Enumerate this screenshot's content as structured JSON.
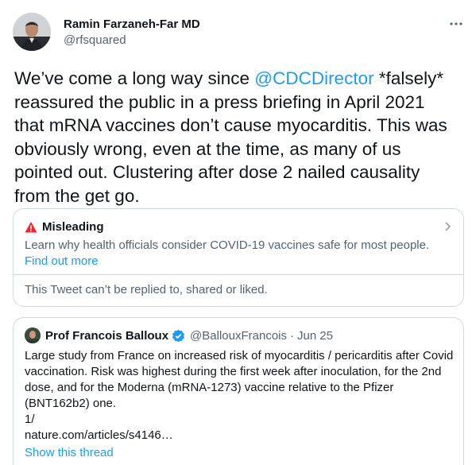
{
  "author": {
    "name": "Ramin Farzaneh-Far MD",
    "handle": "@rfsquared"
  },
  "tweet": {
    "text_before": "We’ve come a long way since ",
    "mention": "@CDCDirector",
    "text_after": " *falsely* reassured the public in a press briefing in April 2021 that mRNA vaccines don’t cause myocarditis.  This was obviously wrong, even at the time, as many of us pointed out.  Clustering after dose 2 nailed causality from the get go."
  },
  "notice": {
    "title": "Misleading",
    "description": "Learn why health officials consider COVID-19 vaccines safe for most people.",
    "link": "Find out more",
    "footer": "This Tweet can’t be replied to, shared or liked."
  },
  "quoted": {
    "name": "Prof Francois Balloux",
    "handle": "@BallouxFrancois",
    "separator": "·",
    "date": "Jun 25",
    "text": "Large study from France on increased risk of myocarditis / pericarditis after Covid vaccination. Risk was highest during the first week after inoculation, for the 2nd dose, and for the Moderna (mRNA-1273) vaccine relative to the Pfizer (BNT162b2) one.\n1/\nnature.com/articles/s4146…",
    "thread_link": "Show this thread"
  },
  "icons": {
    "more": "more-horizontal-icon",
    "warning": "warning-icon",
    "chevron": "chevron-right-icon",
    "verified": "verified-badge-icon"
  },
  "colors": {
    "accent": "#1d9bf0",
    "warning": "#f4212e",
    "text": "#0f1419",
    "secondary": "#536471",
    "border": "#cfd9de"
  }
}
